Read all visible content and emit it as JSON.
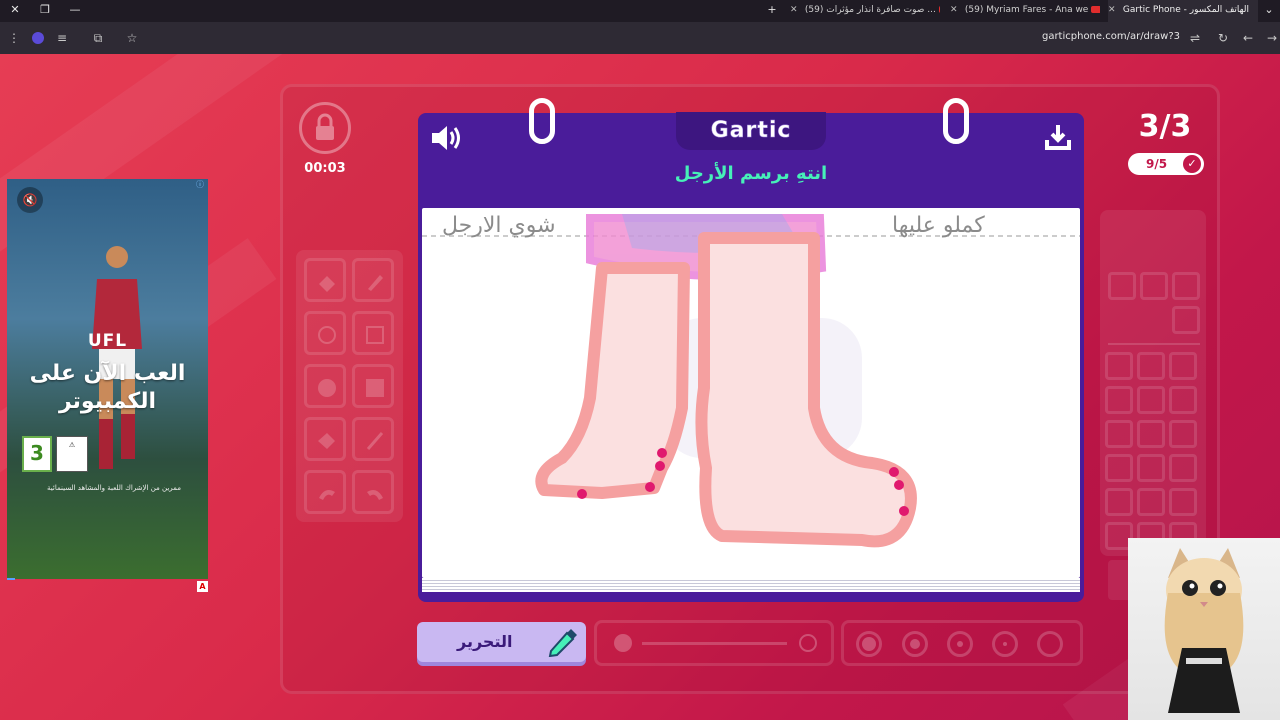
{
  "browser": {
    "tabs": [
      {
        "title": "Gartic Phone - الهاتف المكسور",
        "active": true
      },
      {
        "title": "(59) Myriam Fares - Ana we",
        "active": false
      },
      {
        "title": "(59) صوت صافرة انذار مؤثرات ...",
        "active": false
      }
    ],
    "url": "garticphone.com/ar/draw?3"
  },
  "ad": {
    "brand": "UFL",
    "headline_line1": "العب الآن على",
    "headline_line2": "الكمبيوتر",
    "rating": "3",
    "fine_print": "ممرين من الإشراك اللعبة والمشاهد السينمائية",
    "badge": "A",
    "icons": {
      "mute": "mute-icon",
      "info": "info-icon"
    }
  },
  "game": {
    "timer": "00:03",
    "round": "3/3",
    "progress": "9/5",
    "logo": "Gartic",
    "prompt": "انتهِ برسم الأرجل",
    "canvas_text_left": "شوي الارجل",
    "canvas_text_right": "كملو عليها",
    "edit_button": "التحرير",
    "colors": {
      "purple": "#4a1c9a",
      "teal": "#46f0b8",
      "pink": "#e0196e",
      "bg": "#d92a4a"
    },
    "icons": {
      "lock": "lock-icon",
      "sound": "speaker-icon",
      "download": "download-icon",
      "pencil": "pencil-icon",
      "check": "check-icon"
    }
  }
}
